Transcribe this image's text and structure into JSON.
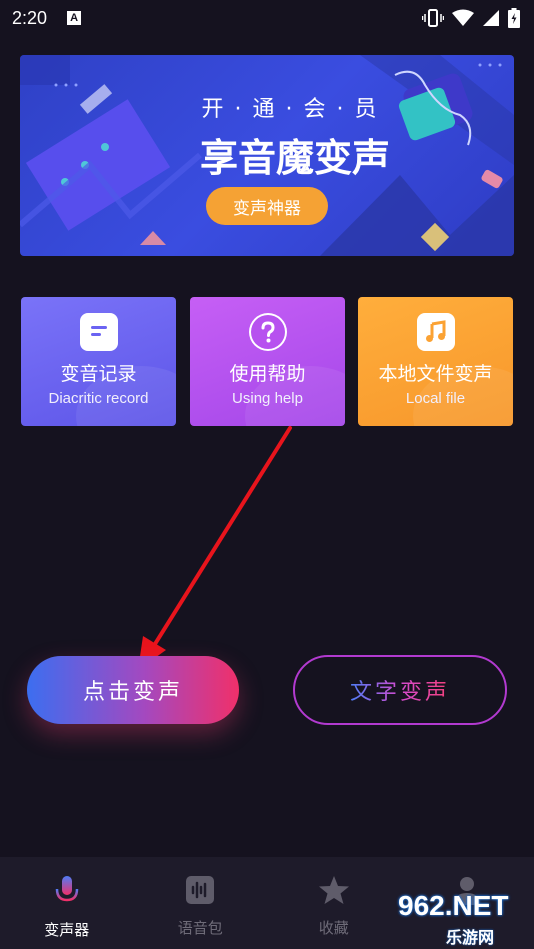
{
  "status": {
    "time": "2:20",
    "notification_icon": "A"
  },
  "banner": {
    "line1": "开 · 通 · 会 · 员",
    "line2": "享音魔变声",
    "button_label": "变声神器"
  },
  "cards": [
    {
      "title": "变音记录",
      "subtitle": "Diacritic record",
      "icon": "document-icon"
    },
    {
      "title": "使用帮助",
      "subtitle": "Using help",
      "icon": "question-icon"
    },
    {
      "title": "本地文件变声",
      "subtitle": "Local file",
      "icon": "music-note-icon"
    }
  ],
  "actions": {
    "voice_change": "点击变声",
    "text_voice": "文字变声"
  },
  "nav": {
    "items": [
      {
        "label": "变声器",
        "icon": "microphone-icon",
        "active": true
      },
      {
        "label": "语音包",
        "icon": "waveform-icon",
        "active": false
      },
      {
        "label": "收藏",
        "icon": "star-icon",
        "active": false
      },
      {
        "label": "",
        "icon": "person-icon",
        "active": false
      }
    ]
  },
  "watermark": {
    "brand": "962.NET",
    "subtitle": "乐游网"
  },
  "colors": {
    "background": "#15121f",
    "banner": "#3a4de0",
    "card_1": "#6b63f2",
    "card_2": "#b752ef",
    "card_3": "#fba233",
    "accent_orange": "#f5a234",
    "arrow": "#e8141c"
  }
}
